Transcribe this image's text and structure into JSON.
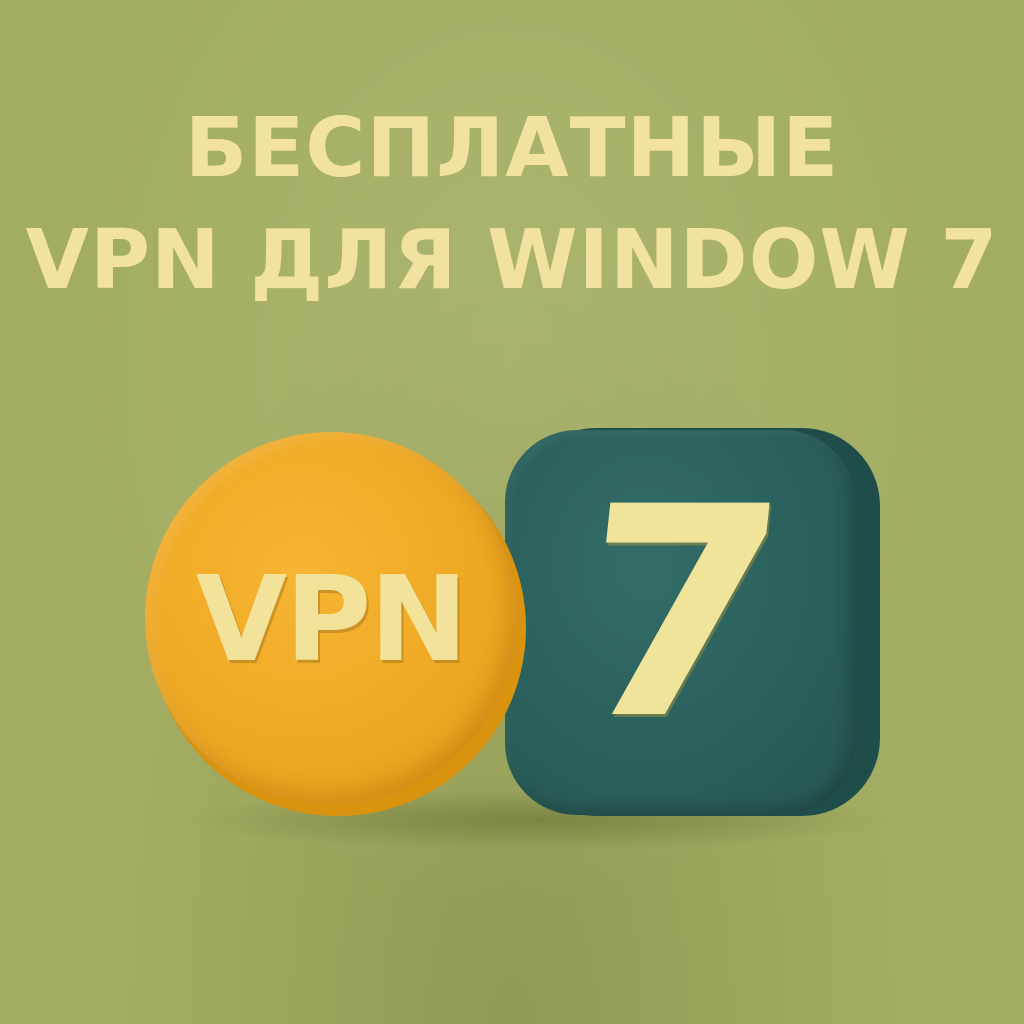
{
  "headline": {
    "line1": "БЕСПЛАТНЫЕ",
    "line2": "VPN ДЛЯ WINDOW 7"
  },
  "badges": {
    "disc_label": "VPN",
    "tile_label": "7"
  },
  "colors": {
    "background": "#a3ad62",
    "headline_text": "#f2e2a2",
    "disc": "#eea823",
    "tile": "#2a5f5b",
    "badge_text": "#f0e39a"
  }
}
